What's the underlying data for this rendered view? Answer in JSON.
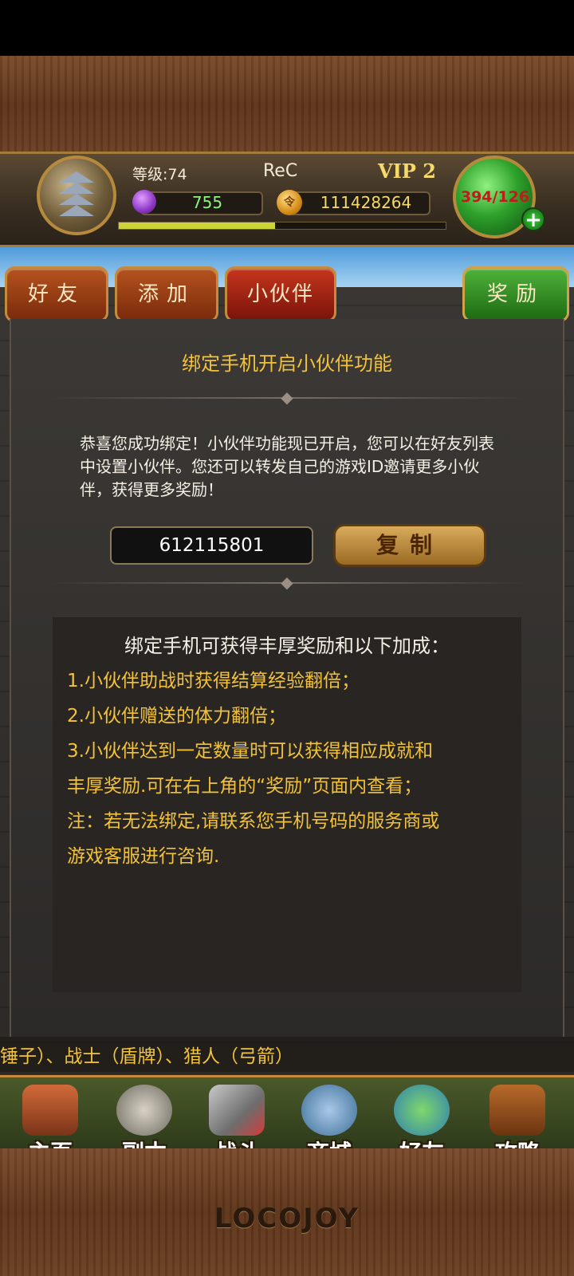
{
  "header": {
    "level_label": "等级:74",
    "player_name": "ReC",
    "vip_label": "VIP 2",
    "gems": "755",
    "gold": "111428264",
    "gold_icon_glyph": "令",
    "hp": "394/126",
    "xp_fraction": 0.48
  },
  "tabs": {
    "friends": "好友",
    "add": "添加",
    "partner": "小伙伴",
    "reward": "奖励"
  },
  "panel": {
    "title": "绑定手机开启小伙伴功能",
    "intro": "恭喜您成功绑定！小伙伴功能现已开启，您可以在好友列表中设置小伙伴。您还可以转发自己的游戏ID邀请更多小伙伴，获得更多奖励！",
    "invite_id": "612115801",
    "copy_label": "复制"
  },
  "bonus": {
    "title": "绑定手机可获得丰厚奖励和以下加成：",
    "line_1": "1.小伙伴助战时获得结算经验翻倍；",
    "line_2": "2.小伙伴赠送的体力翻倍；",
    "line_3a": "3.小伙伴达到一定数量时可以获得相应成就和",
    "line_3b": "丰厚奖励.可在右上角的“奖励”页面内查看；",
    "note_a": "注：若无法绑定,请联系您手机号码的服务商或",
    "note_b": "游戏客服进行咨询."
  },
  "ticker": "锤子）、战士（盾牌）、猎人（弓箭）",
  "nav": {
    "home": "主页",
    "dungeon": "副本",
    "battle": "战斗",
    "shop": "商城",
    "friends": "好友",
    "guide": "攻略"
  },
  "brand": "LOCOJOY",
  "colors": {
    "gold_text": "#f2c23a",
    "tab_red": "#b5531e",
    "tab_green": "#4fb23a"
  }
}
